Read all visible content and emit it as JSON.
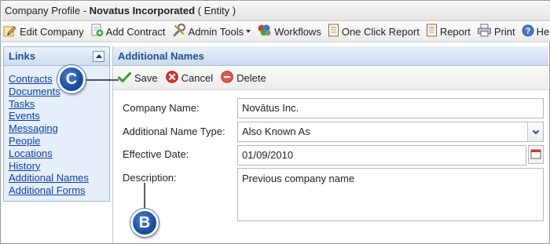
{
  "title": {
    "prefix": "Company Profile -",
    "company": "Novatus Incorporated",
    "suffix": "( Entity )"
  },
  "toolbar": {
    "items": [
      {
        "label": "Edit Company",
        "icon": "edit-company-icon"
      },
      {
        "label": "Add Contract",
        "icon": "add-contract-icon"
      },
      {
        "label": "Admin Tools",
        "icon": "admin-tools-icon"
      },
      {
        "label": "Workflows",
        "icon": "workflows-icon"
      },
      {
        "label": "One Click Report",
        "icon": "report-icon"
      },
      {
        "label": "Report",
        "icon": "report-icon"
      },
      {
        "label": "Print",
        "icon": "print-icon"
      },
      {
        "label": "Help",
        "icon": "help-icon"
      }
    ]
  },
  "sidebar": {
    "title": "Links",
    "items": [
      {
        "label": "Contracts"
      },
      {
        "label": "Documents"
      },
      {
        "label": "Tasks"
      },
      {
        "label": "Events"
      },
      {
        "label": "Messaging"
      },
      {
        "label": "People"
      },
      {
        "label": "Locations"
      },
      {
        "label": "History"
      },
      {
        "label": "Additional Names"
      },
      {
        "label": "Additional Forms"
      }
    ]
  },
  "main": {
    "title": "Additional Names",
    "actions": {
      "save": "Save",
      "cancel": "Cancel",
      "delete": "Delete"
    },
    "form": {
      "company_name_label": "Company Name:",
      "company_name_value": "Novātus Inc.",
      "name_type_label": "Additional Name Type:",
      "name_type_value": "Also Known As",
      "effective_date_label": "Effective Date:",
      "effective_date_value": "01/09/2010",
      "description_label": "Description:",
      "description_value": "Previous company name"
    }
  },
  "callouts": {
    "c": "C",
    "b": "B"
  },
  "colors": {
    "link": "#0b3fa6",
    "panel_header_text": "#1f4f8f",
    "marker": "#1b4e9e"
  }
}
